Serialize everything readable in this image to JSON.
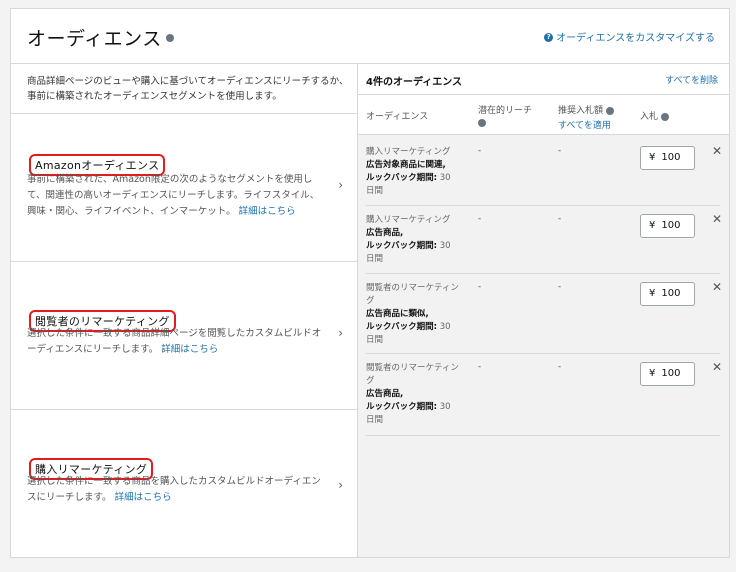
{
  "header": {
    "title": "オーディエンス",
    "customize_link": "オーディエンスをカスタマイズする"
  },
  "left": {
    "intro": "商品詳細ページのビューや購入に基づいてオーディエンスにリーチするか、事前に構築されたオーディエンスセグメントを使用します。",
    "options": [
      {
        "title": "Amazonオーディエンス",
        "desc": "事前に構築された、Amazon限定の次のようなセグメントを使用して、関連性の高いオーディエンスにリーチします。ライフスタイル、興味・関心、ライフイベント、インマーケット。",
        "more": "詳細はこちら"
      },
      {
        "title": "閲覧者のリマーケティング",
        "desc": "選択した条件に一致する商品詳細ページを閲覧したカスタムビルドオーディエンスにリーチします。",
        "more": "詳細はこちら"
      },
      {
        "title": "購入リマーケティング",
        "desc": "選択した条件に一致する商品を購入したカスタムビルドオーディエンスにリーチします。",
        "more": "詳細はこちら"
      }
    ]
  },
  "right": {
    "count_label": "4件のオーディエンス",
    "remove_all": "すべてを削除",
    "columns": {
      "audience": "オーディエンス",
      "reach": "潜在的リーチ",
      "suggested_bid": "推奨入札額",
      "apply_all": "すべてを適用",
      "bid": "入札"
    },
    "rows": [
      {
        "type": "購入リマーケティング",
        "detail1": "広告対象商品に関連,",
        "lookback_label": "ルックバック期間:",
        "lookback_value": "30",
        "unit": "日間",
        "reach": "-",
        "suggested": "-",
        "currency": "¥",
        "bid": "100"
      },
      {
        "type": "購入リマーケティング",
        "detail1": "広告商品,",
        "lookback_label": "ルックバック期間:",
        "lookback_value": "30",
        "unit": "日間",
        "reach": "-",
        "suggested": "-",
        "currency": "¥",
        "bid": "100"
      },
      {
        "type": "閲覧者のリマーケティング",
        "detail1": "広告商品に類似,",
        "lookback_label": "ルックバック期間:",
        "lookback_value": "30",
        "unit": "日間",
        "reach": "-",
        "suggested": "-",
        "currency": "¥",
        "bid": "100"
      },
      {
        "type": "閲覧者のリマーケティング",
        "detail1": "広告商品,",
        "lookback_label": "ルックバック期間:",
        "lookback_value": "30",
        "unit": "日間",
        "reach": "-",
        "suggested": "-",
        "currency": "¥",
        "bid": "100"
      }
    ],
    "close_glyph": "✕"
  },
  "icons": {
    "chevron": "›",
    "question": "?"
  },
  "colors": {
    "link": "#1f6fa9",
    "highlight": "#e01e1e"
  }
}
